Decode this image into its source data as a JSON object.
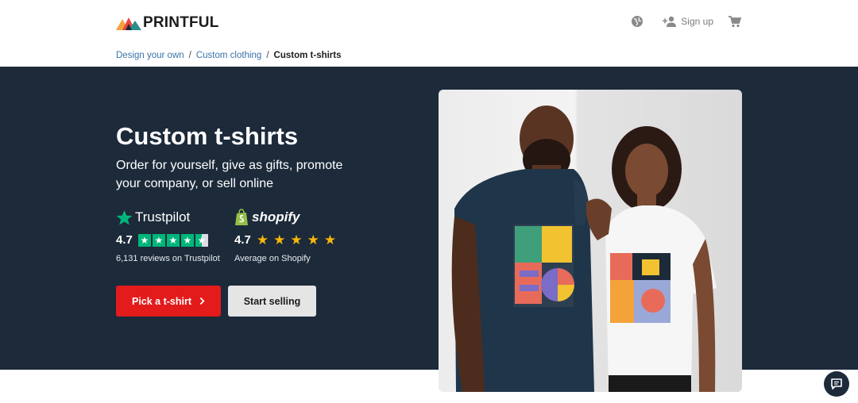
{
  "header": {
    "logo_text": "PRINTFUL",
    "signup_label": "Sign up",
    "icons": [
      "globe-icon",
      "user-plus-icon",
      "cart-icon"
    ]
  },
  "breadcrumb": {
    "items": [
      "Design your own",
      "Custom clothing",
      "Custom t-shirts"
    ],
    "separator": "/"
  },
  "hero": {
    "title": "Custom t-shirts",
    "subtitle": "Order for yourself, give as gifts, promote your company, or sell online",
    "background_color": "#1c2a3a",
    "trustpilot": {
      "brand": "Trustpilot",
      "score": "4.7",
      "stars_filled": 4.5,
      "caption": "6,131 reviews on Trustpilot",
      "color": "#00b67a"
    },
    "shopify": {
      "brand": "shopify",
      "score": "4.7",
      "stars_filled": 5,
      "caption": "Average on Shopify",
      "star_color": "#f5b70a"
    },
    "primary_button": "Pick a t-shirt",
    "secondary_button": "Start selling",
    "accent_color": "#e31b1b"
  },
  "chat": {
    "icon": "chat-icon"
  }
}
